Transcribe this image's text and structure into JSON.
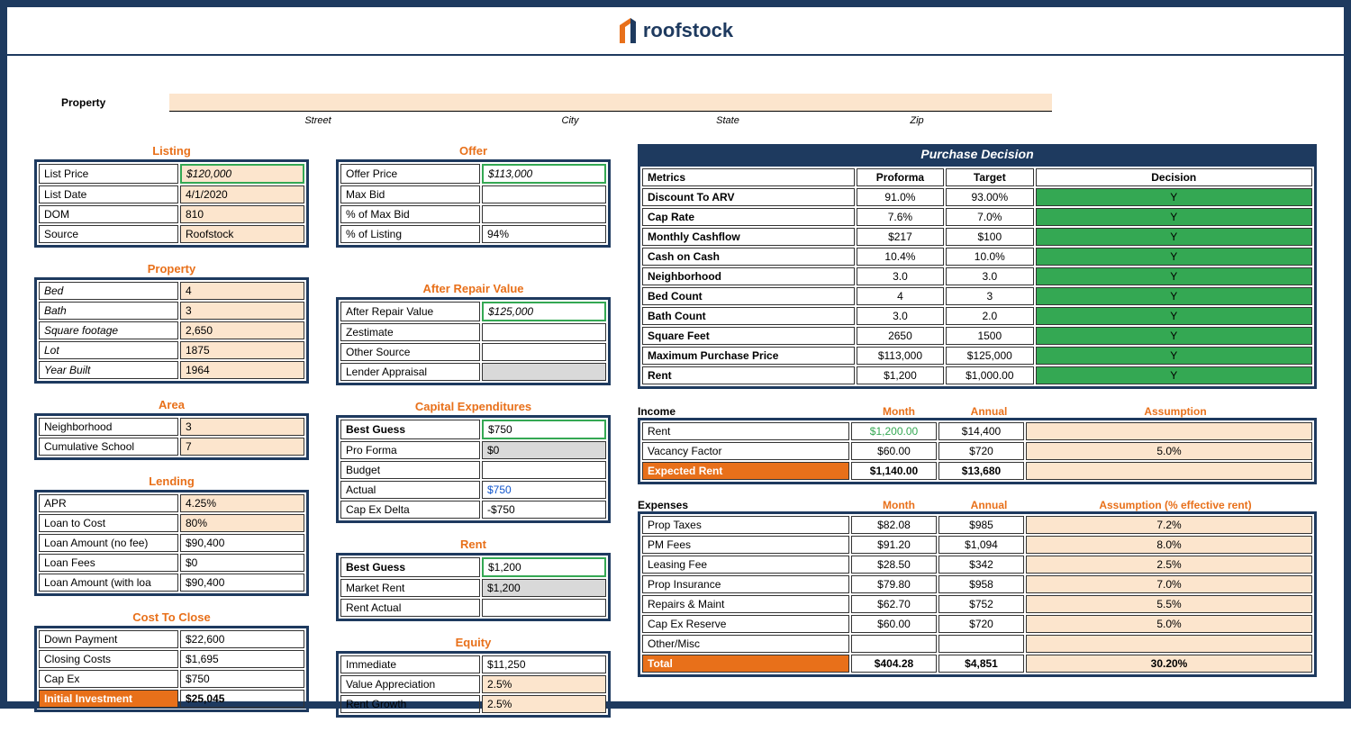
{
  "logo": "roofstock",
  "propLabel": "Property",
  "propCaps": [
    "Street",
    "City",
    "State",
    "Zip"
  ],
  "listing": {
    "h": "Listing",
    "rows": [
      [
        "List Price",
        "$120,000"
      ],
      [
        "List Date",
        "4/1/2020"
      ],
      [
        "DOM",
        "810"
      ],
      [
        "Source",
        "Roofstock"
      ]
    ]
  },
  "property": {
    "h": "Property",
    "rows": [
      [
        "Bed",
        "4"
      ],
      [
        "Bath",
        "3"
      ],
      [
        "Square footage",
        "2,650"
      ],
      [
        "Lot",
        "1875"
      ],
      [
        "Year Built",
        "1964"
      ]
    ]
  },
  "area": {
    "h": "Area",
    "rows": [
      [
        "Neighborhood",
        "3"
      ],
      [
        "Cumulative School",
        "7"
      ]
    ]
  },
  "lending": {
    "h": "Lending",
    "rows": [
      [
        "APR",
        "4.25%"
      ],
      [
        "Loan to Cost",
        "80%"
      ],
      [
        "Loan Amount (no fee)",
        "$90,400"
      ],
      [
        "Loan Fees",
        "$0"
      ],
      [
        "Loan Amount (with loa",
        "$90,400"
      ]
    ]
  },
  "ctc": {
    "h": "Cost To Close",
    "rows": [
      [
        "Down Payment",
        "$22,600"
      ],
      [
        "Closing Costs",
        "$1,695"
      ],
      [
        "Cap Ex",
        "$750"
      ],
      [
        "Initial Investment",
        "$25,045"
      ]
    ]
  },
  "offer": {
    "h": "Offer",
    "rows": [
      [
        "Offer Price",
        "$113,000"
      ],
      [
        "Max Bid",
        ""
      ],
      [
        "% of Max Bid",
        ""
      ],
      [
        "% of Listing",
        "94%"
      ]
    ]
  },
  "arv": {
    "h": "After Repair Value",
    "rows": [
      [
        "After Repair Value",
        "$125,000"
      ],
      [
        "Zestimate",
        ""
      ],
      [
        "Other Source",
        ""
      ],
      [
        "Lender Appraisal",
        ""
      ]
    ]
  },
  "capex": {
    "h": "Capital Expenditures",
    "rows": [
      [
        "Best Guess",
        "$750"
      ],
      [
        "Pro Forma",
        "$0"
      ],
      [
        "Budget",
        ""
      ],
      [
        "Actual",
        "$750"
      ],
      [
        "Cap Ex Delta",
        "-$750"
      ]
    ]
  },
  "rent": {
    "h": "Rent",
    "rows": [
      [
        "Best Guess",
        "$1,200"
      ],
      [
        "Market Rent",
        "$1,200"
      ],
      [
        "Rent Actual",
        ""
      ]
    ]
  },
  "equity": {
    "h": "Equity",
    "rows": [
      [
        "Immediate",
        "$11,250"
      ],
      [
        "Value Appreciation",
        "2.5%"
      ],
      [
        "Rent Growth",
        "2.5%"
      ]
    ]
  },
  "pd": {
    "h": "Purchase Decision",
    "cols": [
      "Metrics",
      "Proforma",
      "Target",
      "Decision"
    ],
    "rows": [
      [
        "Discount To ARV",
        "91.0%",
        "93.00%",
        "Y"
      ],
      [
        "Cap Rate",
        "7.6%",
        "7.0%",
        "Y"
      ],
      [
        "Monthly Cashflow",
        "$217",
        "$100",
        "Y"
      ],
      [
        "Cash on Cash",
        "10.4%",
        "10.0%",
        "Y"
      ],
      [
        "Neighborhood",
        "3.0",
        "3.0",
        "Y"
      ],
      [
        "Bed Count",
        "4",
        "3",
        "Y"
      ],
      [
        "Bath Count",
        "3.0",
        "2.0",
        "Y"
      ],
      [
        "Square Feet",
        "2650",
        "1500",
        "Y"
      ],
      [
        "Maximum Purchase Price",
        "$113,000",
        "$125,000",
        "Y"
      ],
      [
        "Rent",
        "$1,200",
        "$1,000.00",
        "Y"
      ]
    ]
  },
  "income": {
    "h": "Income",
    "cols": [
      "Month",
      "Annual",
      "Assumption"
    ],
    "rows": [
      [
        "Rent",
        "$1,200.00",
        "$14,400",
        ""
      ],
      [
        "Vacancy Factor",
        "$60.00",
        "$720",
        "5.0%"
      ],
      [
        "Expected Rent",
        "$1,140.00",
        "$13,680",
        ""
      ]
    ]
  },
  "expenses": {
    "h": "Expenses",
    "cols": [
      "Month",
      "Annual",
      "Assumption (% effective rent)"
    ],
    "rows": [
      [
        "Prop Taxes",
        "$82.08",
        "$985",
        "7.2%"
      ],
      [
        "PM Fees",
        "$91.20",
        "$1,094",
        "8.0%"
      ],
      [
        "Leasing Fee",
        "$28.50",
        "$342",
        "2.5%"
      ],
      [
        "Prop Insurance",
        "$79.80",
        "$958",
        "7.0%"
      ],
      [
        "Repairs & Maint",
        "$62.70",
        "$752",
        "5.5%"
      ],
      [
        "Cap Ex Reserve",
        "$60.00",
        "$720",
        "5.0%"
      ],
      [
        "Other/Misc",
        "",
        "",
        ""
      ],
      [
        "Total",
        "$404.28",
        "$4,851",
        "30.20%"
      ]
    ]
  }
}
